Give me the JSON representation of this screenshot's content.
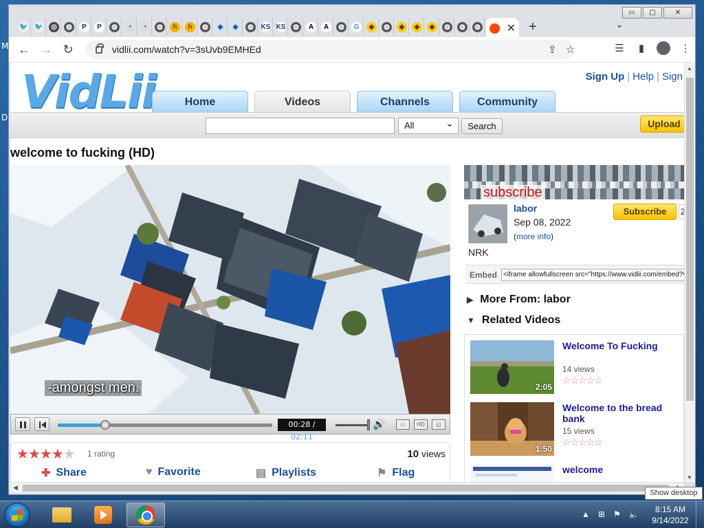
{
  "desktop": {
    "frag_m": "M",
    "frag_d": "D"
  },
  "window": {
    "min_glyph": "▭",
    "max_glyph": "□",
    "close_glyph": "✕"
  },
  "tabs": {
    "pinned": [
      {
        "icon": "bird-icon",
        "glyph": "🐦",
        "bg": "#f0f0f0",
        "fg": "#555"
      },
      {
        "icon": "bird-icon",
        "glyph": "🐦",
        "bg": "#f0f0f0",
        "fg": "#555"
      },
      {
        "icon": "chrome-icon",
        "glyph": "◎",
        "bg": "#444",
        "fg": "#fff"
      },
      {
        "icon": "globe-icon",
        "glyph": "◍",
        "bg": "#555",
        "fg": "#fff"
      },
      {
        "icon": "p-icon",
        "glyph": "P",
        "bg": "#fff",
        "fg": "#333"
      },
      {
        "icon": "p-icon",
        "glyph": "P",
        "bg": "#fff",
        "fg": "#333"
      },
      {
        "icon": "globe-icon",
        "glyph": "◍",
        "bg": "#555",
        "fg": "#fff"
      },
      {
        "icon": "disc-icon",
        "glyph": "◔",
        "bg": "#ddd",
        "fg": "#333"
      },
      {
        "icon": "disc-icon",
        "glyph": "◔",
        "bg": "#ddd",
        "fg": "#333"
      },
      {
        "icon": "globe-icon",
        "glyph": "◍",
        "bg": "#555",
        "fg": "#fff"
      },
      {
        "icon": "h-icon",
        "glyph": "h",
        "bg": "#f5b400",
        "fg": "#7a4b00"
      },
      {
        "icon": "h-icon",
        "glyph": "h",
        "bg": "#f5b400",
        "fg": "#7a4b00"
      },
      {
        "icon": "globe-icon",
        "glyph": "◍",
        "bg": "#555",
        "fg": "#fff"
      },
      {
        "icon": "pill-icon",
        "glyph": "◈",
        "bg": "#cfe3ff",
        "fg": "#1a4fa0"
      },
      {
        "icon": "pill-icon",
        "glyph": "◈",
        "bg": "#cfe3ff",
        "fg": "#1a4fa0"
      },
      {
        "icon": "globe-icon",
        "glyph": "◍",
        "bg": "#555",
        "fg": "#fff"
      },
      {
        "icon": "ks-icon",
        "glyph": "KS",
        "bg": "#fff",
        "fg": "#1a3a7a"
      },
      {
        "icon": "ks-icon",
        "glyph": "KS",
        "bg": "#fff",
        "fg": "#1a3a7a"
      },
      {
        "icon": "globe-icon",
        "glyph": "◍",
        "bg": "#555",
        "fg": "#fff"
      },
      {
        "icon": "letter-a-icon",
        "glyph": "A",
        "bg": "#fff",
        "fg": "#000"
      },
      {
        "icon": "letter-a-icon",
        "glyph": "A",
        "bg": "#fff",
        "fg": "#000"
      },
      {
        "icon": "globe-icon",
        "glyph": "◍",
        "bg": "#555",
        "fg": "#fff"
      },
      {
        "icon": "google-icon",
        "glyph": "G",
        "bg": "#fff",
        "fg": "#4285f4"
      },
      {
        "icon": "diamond-icon",
        "glyph": "◆",
        "bg": "#f2d600",
        "fg": "#8a1d6b"
      },
      {
        "icon": "globe-icon",
        "glyph": "◍",
        "bg": "#555",
        "fg": "#fff"
      },
      {
        "icon": "diamond-icon",
        "glyph": "◆",
        "bg": "#f2d600",
        "fg": "#8a1d6b"
      },
      {
        "icon": "diamond-icon",
        "glyph": "◆",
        "bg": "#f2d600",
        "fg": "#8a1d6b"
      },
      {
        "icon": "diamond-icon",
        "glyph": "◆",
        "bg": "#f2d600",
        "fg": "#8a1d6b"
      },
      {
        "icon": "globe-icon",
        "glyph": "◍",
        "bg": "#555",
        "fg": "#fff"
      },
      {
        "icon": "globe-icon",
        "glyph": "◍",
        "bg": "#555",
        "fg": "#fff"
      },
      {
        "icon": "globe-icon",
        "glyph": "◍",
        "bg": "#555",
        "fg": "#fff"
      }
    ],
    "active_close": "✕",
    "new_tab": "+",
    "menu": "⌄"
  },
  "toolbar": {
    "back": "←",
    "forward": "→",
    "reload": "↻",
    "url": "vidlii.com/watch?v=3sUvb9EMHEd",
    "share": "⇪",
    "star": "☆",
    "media": "☰",
    "sidebar": "▮",
    "menu": "⋮"
  },
  "site": {
    "logo": "VidLii",
    "links": {
      "signup": "Sign Up",
      "sep1": "|",
      "help": "Help",
      "sep2": "|",
      "signin": "Sign"
    },
    "nav": [
      "Home",
      "Videos",
      "Channels",
      "Community"
    ],
    "search": {
      "value": "",
      "select": "All",
      "button": "Search"
    },
    "upload": "Upload"
  },
  "video": {
    "title": "welcome to fucking (HD)",
    "subtitle": "-amongst men.",
    "time_current": "00:28",
    "time_sep": " / ",
    "time_total": "02:11",
    "progress": 0.22,
    "volume": 1.0,
    "hd_label": "HD",
    "rating": 4,
    "rating_text": "1 rating",
    "views_count": "10",
    "views_label": "views",
    "actions": {
      "share": "Share",
      "favorite": "Favorite",
      "playlists": "Playlists",
      "flag": "Flag"
    }
  },
  "channel": {
    "banner_text": "subscribe",
    "name": "labor",
    "date": "Sep 08, 2022",
    "more_open": "(",
    "more_info": "more info",
    "more_close": ")",
    "description": "NRK",
    "subscribe": "Subscribe",
    "sub_count": "2",
    "embed_label": "Embed",
    "embed_code": "<iframe allowfullscreen src=\"https://www.vidlii.com/embed?v"
  },
  "sections": {
    "more_from": "More From: labor",
    "related": "Related Videos"
  },
  "related": [
    {
      "title": "Welcome To Fucking",
      "views": "14 views",
      "duration": "2:05"
    },
    {
      "title": "Welcome to the bread bank",
      "views": "15 views",
      "duration": "1:50"
    },
    {
      "title": "welcome",
      "views": "",
      "duration": ""
    }
  ],
  "taskbar": {
    "tooltip": "Show desktop",
    "time": "8:15 AM",
    "date": "9/14/2022",
    "tray": [
      "▲",
      "⊞",
      "⚑",
      "🔈"
    ]
  }
}
